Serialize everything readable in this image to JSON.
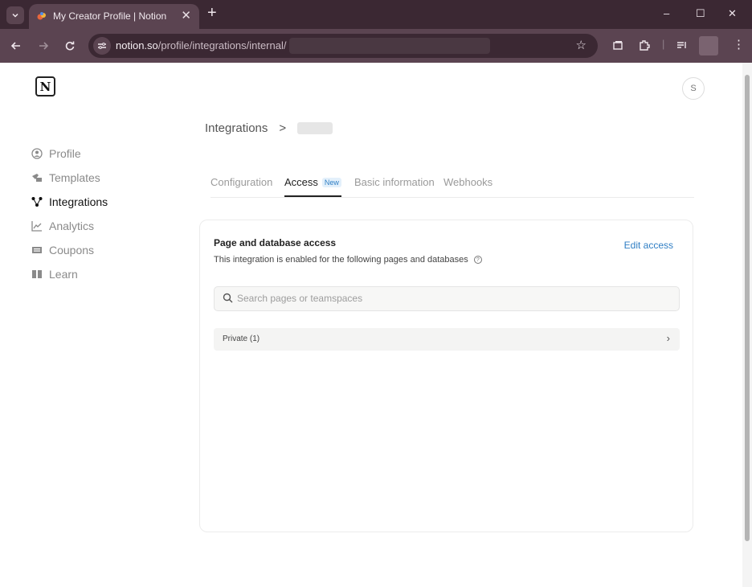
{
  "browser": {
    "tab_title": "My Creator Profile | Notion",
    "tab_close": "✕",
    "new_tab": "+",
    "url_domain": "notion.so",
    "url_path": "/profile/integrations/internal/",
    "window_controls": {
      "minimize": "–",
      "maximize": "☐",
      "close": "✕"
    }
  },
  "page": {
    "logo_letter": "N",
    "user_initial": "S",
    "sidebar": {
      "items": [
        {
          "label": "Profile",
          "icon": "person-circle-icon",
          "active": false
        },
        {
          "label": "Templates",
          "icon": "templates-icon",
          "active": false
        },
        {
          "label": "Integrations",
          "icon": "integrations-icon",
          "active": true
        },
        {
          "label": "Analytics",
          "icon": "chart-icon",
          "active": false
        },
        {
          "label": "Coupons",
          "icon": "coupon-icon",
          "active": false
        },
        {
          "label": "Learn",
          "icon": "book-icon",
          "active": false
        }
      ]
    },
    "breadcrumb": {
      "root": "Integrations",
      "separator": ">"
    },
    "tabs": [
      {
        "label": "Configuration",
        "active": false
      },
      {
        "label": "Access",
        "active": true,
        "badge": "New"
      },
      {
        "label": "Basic information",
        "active": false
      },
      {
        "label": "Webhooks",
        "active": false
      }
    ],
    "access_card": {
      "title": "Page and database access",
      "subtitle": "This integration is enabled for the following pages and databases",
      "help_glyph": "?",
      "edit_label": "Edit access",
      "search_placeholder": "Search pages or teamspaces",
      "groups": [
        {
          "label": "Private (1)"
        }
      ]
    },
    "colors": {
      "accent": "#2f7ec4",
      "badge_bg": "#e3f0fb",
      "browser_frame": "#5b4451"
    }
  }
}
